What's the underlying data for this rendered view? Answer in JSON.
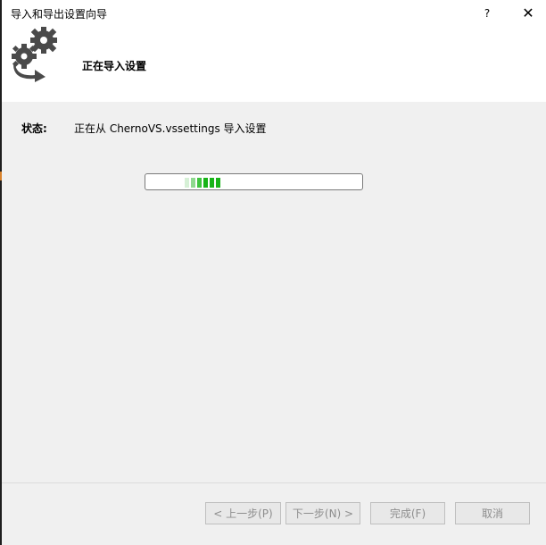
{
  "window": {
    "title": "导入和导出设置向导",
    "help_label": "?",
    "close_label": "✕"
  },
  "header": {
    "heading": "正在导入设置",
    "icon": "gears-arrow-icon"
  },
  "status": {
    "label": "状态:",
    "text": "正在从 ChernoVS.vssettings 导入设置"
  },
  "progress": {
    "style": "indeterminate marquee",
    "color": "#17b317"
  },
  "buttons": {
    "prev_label": "< 上一步(P)",
    "next_label": "下一步(N) >",
    "finish_label": "完成(F)",
    "cancel_label": "取消"
  }
}
